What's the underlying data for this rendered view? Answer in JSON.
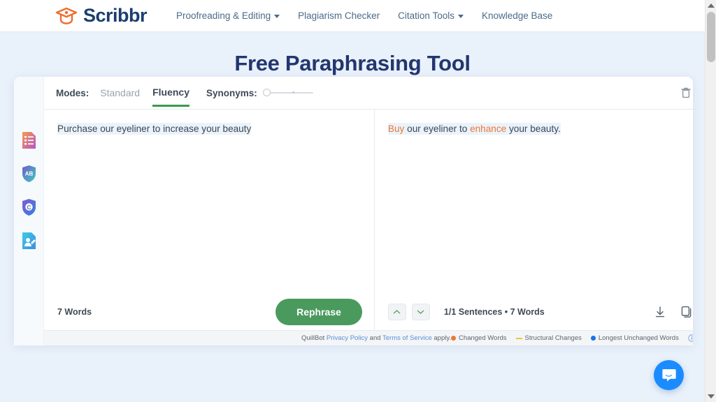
{
  "brand": {
    "name": "Scribbr",
    "logo_icon": "graduation-cap-icon",
    "color": "#1b3e6f",
    "accent": "#ef6c2e"
  },
  "nav": {
    "items": [
      {
        "label": "Proofreading & Editing",
        "has_dropdown": true
      },
      {
        "label": "Plagiarism Checker",
        "has_dropdown": false
      },
      {
        "label": "Citation Tools",
        "has_dropdown": true
      },
      {
        "label": "Knowledge Base",
        "has_dropdown": false
      }
    ]
  },
  "page": {
    "title": "Free Paraphrasing Tool"
  },
  "rail": {
    "items": [
      {
        "name": "proofreading-icon",
        "title": "Proofreading & Editing"
      },
      {
        "name": "grammar-checker-icon",
        "title": "Grammar Checker"
      },
      {
        "name": "plagiarism-checker-icon",
        "title": "Plagiarism Checker"
      },
      {
        "name": "citation-generator-icon",
        "title": "Citation Generator"
      }
    ]
  },
  "toolbar": {
    "modes_label": "Modes:",
    "modes": [
      {
        "label": "Standard",
        "active": false
      },
      {
        "label": "Fluency",
        "active": true
      }
    ],
    "synonyms_label": "Synonyms:",
    "synonyms_value": 0,
    "delete_icon": "trash-icon"
  },
  "editor": {
    "input": {
      "text": "Purchase our eyeliner to increase your beauty",
      "word_count": "7 Words",
      "rephrase_label": "Rephrase"
    },
    "output": {
      "segments": [
        {
          "text": "Buy",
          "changed": true
        },
        {
          "text": " our eyeliner to ",
          "changed": false
        },
        {
          "text": "enhance",
          "changed": true
        },
        {
          "text": " your beauty.",
          "changed": false
        }
      ],
      "stats": "1/1 Sentences • 7 Words",
      "prev_icon": "chevron-up-icon",
      "next_icon": "chevron-down-icon",
      "download_icon": "download-icon",
      "copy_icon": "copy-icon"
    }
  },
  "footer": {
    "prefix": "QuillBot ",
    "privacy_label": "Privacy Policy",
    "middle": " and ",
    "terms_label": "Terms of Service",
    "suffix": " apply.",
    "legend": [
      {
        "label": "Changed Words",
        "marker": "dot",
        "color": "#ee7733"
      },
      {
        "label": "Structural Changes",
        "marker": "dash",
        "color": "#f0c33c"
      },
      {
        "label": "Longest Unchanged Words",
        "marker": "dot",
        "color": "#1a73e8"
      }
    ],
    "info_icon": "info-icon"
  },
  "chat": {
    "icon": "chat-bubble-icon",
    "color": "#1a8cff"
  },
  "scrollbar": {
    "position": "right"
  }
}
